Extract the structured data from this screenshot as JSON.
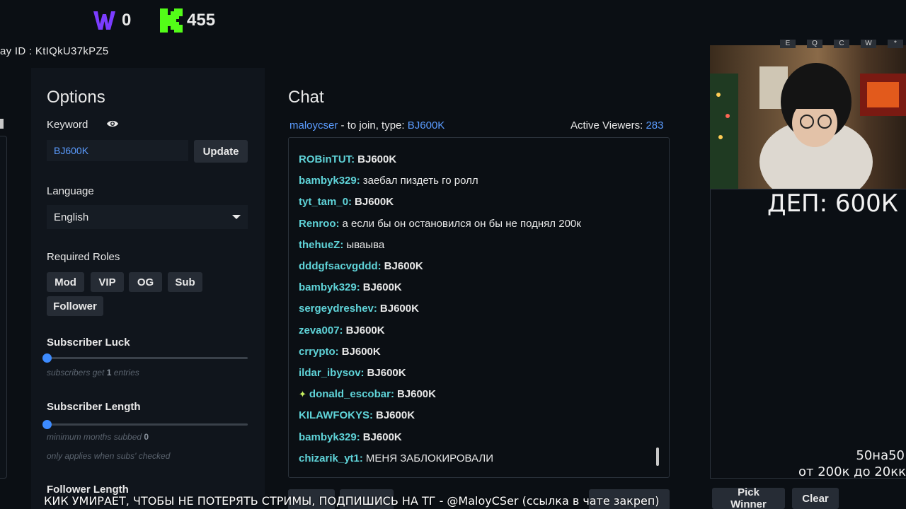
{
  "top": {
    "wallet_w_value": "0",
    "wallet_k_value": "455",
    "play_id": "ay ID :  KtIQkU37kPZ5"
  },
  "options": {
    "title": "Options",
    "keyword_label": "Keyword",
    "keyword_value": "BJ600K",
    "update_label": "Update",
    "language_label": "Language",
    "language_value": "English",
    "required_roles_label": "Required Roles",
    "roles": [
      "Mod",
      "VIP",
      "OG",
      "Sub",
      "Follower"
    ],
    "subscriber_luck_label": "Subscriber Luck",
    "subscriber_luck_value": 1,
    "subscriber_luck_hint_pre": "subscribers get ",
    "subscriber_luck_hint_val": "1",
    "subscriber_luck_hint_post": " entries",
    "subscriber_length_label": "Subscriber Length",
    "subscriber_length_value": 0,
    "subscriber_length_hint_pre": "minimum months subbed ",
    "subscriber_length_hint_val": "0",
    "subscriber_length_note": "only applies when subs' checked",
    "follower_length_label": "Follower Length"
  },
  "chat": {
    "title": "Chat",
    "streamer": "maloycser",
    "join_text": " - to join, type: ",
    "keyword": "BJ600K",
    "viewers_label": "Active Viewers:",
    "viewers_count": "283",
    "messages": [
      {
        "user": "ROBinTUT:",
        "text": "BJ600K",
        "kw": true
      },
      {
        "user": "bambyk329:",
        "text": "заебал пиздеть го ролл",
        "kw": false
      },
      {
        "user": "tyt_tam_0:",
        "text": "BJ600K",
        "kw": true
      },
      {
        "user": "Renroo:",
        "text": "а если бы он остановился он бы не поднял 200к",
        "kw": false
      },
      {
        "user": "thehueZ:",
        "text": "ываыва",
        "kw": false
      },
      {
        "user": "dddgfsacvgddd:",
        "text": "BJ600K",
        "kw": true
      },
      {
        "user": "bambyk329:",
        "text": "BJ600K",
        "kw": true
      },
      {
        "user": "sergeydreshev:",
        "text": "BJ600K",
        "kw": true
      },
      {
        "user": "zeva007:",
        "text": "BJ600K",
        "kw": true
      },
      {
        "user": "crrypto:",
        "text": "BJ600K",
        "kw": true
      },
      {
        "user": "ildar_ibysov:",
        "text": "BJ600K",
        "kw": true
      },
      {
        "user": "donald_escobar:",
        "text": "BJ600K",
        "kw": true,
        "badge": "✦"
      },
      {
        "user": "KILAWFOKYS:",
        "text": "BJ600K",
        "kw": true
      },
      {
        "user": "bambyk329:",
        "text": "BJ600K",
        "kw": true
      },
      {
        "user": "chizarik_yt1:",
        "text": "МЕНЯ ЗАБЛОКИРОВАЛИ",
        "kw": false
      }
    ]
  },
  "overlay": {
    "dep_text": "ДЕП: 600К",
    "corner_line1": "50на50",
    "corner_line2": "от 200к до 20кк",
    "ticker": "КИК УМИРАЕТ, ЧТОБЫ НЕ ПОТЕРЯТЬ СТРИМЫ, ПОДПИШИСЬ НА ТГ - @MaloyCSer (ссылка в чате закреп)",
    "keys": [
      "E",
      "Q",
      "C",
      "W",
      "*"
    ]
  },
  "actions": {
    "pick_winner": "Pick Winner",
    "clear": "Clear"
  },
  "colors": {
    "accent_blue": "#5b9cff",
    "username": "#5fd3d8",
    "kick_green": "#53fc18",
    "w_purple": "#7b3cff"
  }
}
